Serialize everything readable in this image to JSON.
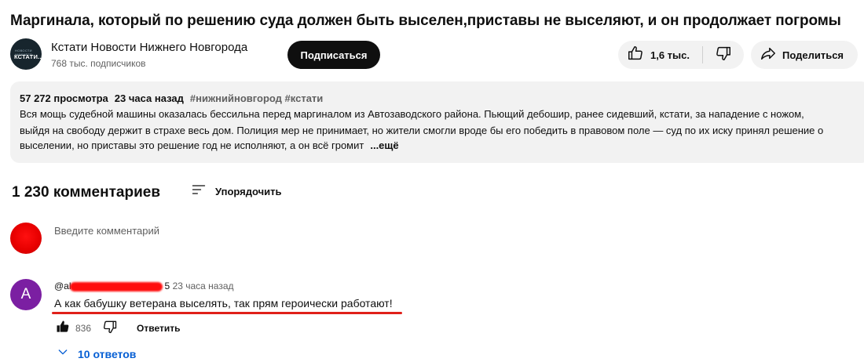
{
  "video": {
    "title": "Маргинала, который по решению суда должен быть выселен,приставы не выселяют, и он продолжает погромы"
  },
  "channel": {
    "name": "Кстати Новости Нижнего Новгорода",
    "subscribers": "768 тыс. подписчиков",
    "avatar_small_text": "НОВОСТИ НИЖНЕГО",
    "avatar_big_text": "КСТАТИ..."
  },
  "actions": {
    "subscribe_label": "Подписаться",
    "like_count": "1,6 тыс.",
    "share_label": "Поделиться"
  },
  "description": {
    "views": "57 272 просмотра",
    "time": "23 часа назад",
    "tags": "#нижнийновгород #кстати",
    "line1": "Вся мощь судебной машины оказалась бессильна перед маргиналом из Автозаводского района. Пьющий дебошир, ранее сидевший, кстати, за нападение с ножом,",
    "line2": "выйдя на свободу держит в страхе весь дом. Полиция мер не принимает, но жители смогли вроде бы его победить в правовом поле — суд по их иску принял решение о",
    "line3": "выселении, но приставы это решение год не исполняют, а он всё громит",
    "more_label": "...ещё"
  },
  "comments": {
    "count_label": "1 230 комментариев",
    "sort_label": "Упорядочить",
    "input_placeholder": "Введите комментарий",
    "items": [
      {
        "avatar_letter": "A",
        "author_prefix": "@al",
        "author_suffix": "5",
        "time": "23 часа назад",
        "text": "А как бабушку ветерана выселять, так прям героически работают!",
        "like_count": "836",
        "reply_label": "Ответить",
        "replies_label": "10 ответов"
      }
    ]
  },
  "colors": {
    "accent_blue": "#065fd4",
    "highlight_red": "#e0201a",
    "comment_avatar": "#7b1fa2"
  }
}
